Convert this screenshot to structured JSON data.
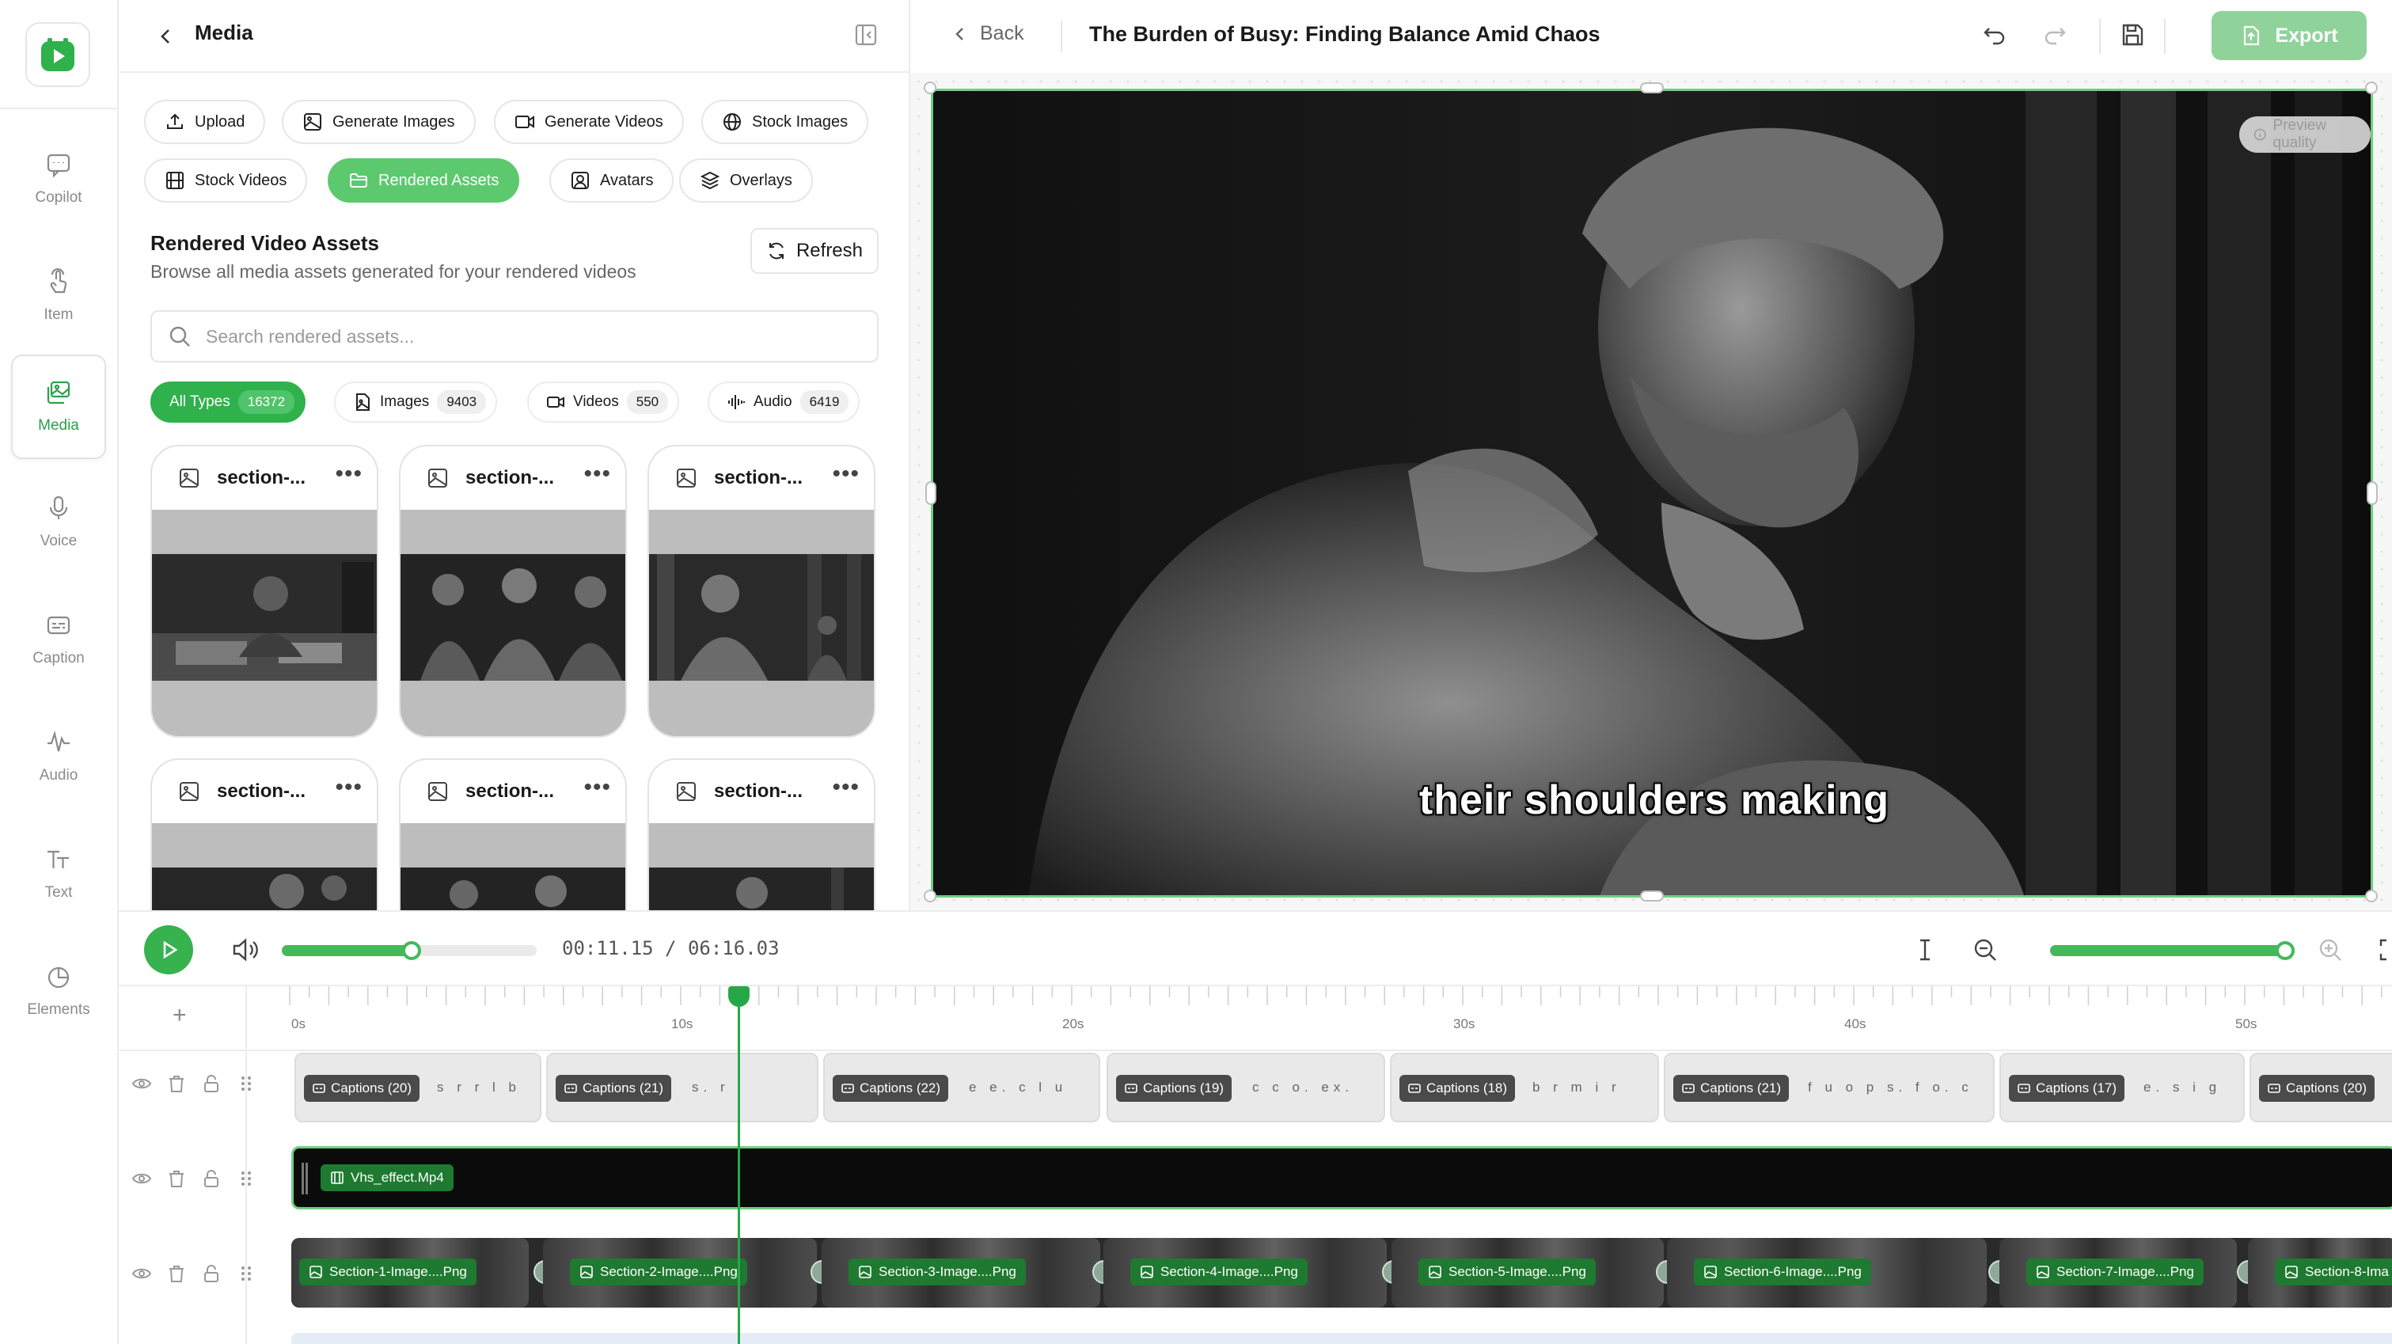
{
  "rail": {
    "items": [
      {
        "label": "Copilot",
        "icon": "chat-icon"
      },
      {
        "label": "Item",
        "icon": "pointer-icon"
      },
      {
        "label": "Media",
        "icon": "media-icon",
        "active": true
      },
      {
        "label": "Voice",
        "icon": "microphone-icon"
      },
      {
        "label": "Caption",
        "icon": "caption-icon"
      },
      {
        "label": "Audio",
        "icon": "audio-wave-icon"
      },
      {
        "label": "Text",
        "icon": "text-icon"
      },
      {
        "label": "Elements",
        "icon": "elements-icon"
      }
    ]
  },
  "panel": {
    "title": "Media",
    "sources": [
      {
        "label": "Upload",
        "icon": "upload-icon"
      },
      {
        "label": "Generate Images",
        "icon": "image-icon"
      },
      {
        "label": "Generate Videos",
        "icon": "video-icon"
      },
      {
        "label": "Stock Images",
        "icon": "globe-icon"
      },
      {
        "label": "Stock Videos",
        "icon": "film-icon"
      },
      {
        "label": "Rendered Assets",
        "icon": "folder-icon",
        "active": true
      },
      {
        "label": "Avatars",
        "icon": "avatar-icon"
      },
      {
        "label": "Overlays",
        "icon": "layers-icon"
      }
    ],
    "section_title": "Rendered Video Assets",
    "section_subtitle": "Browse all media assets generated for your rendered videos",
    "refresh_label": "Refresh",
    "search_placeholder": "Search rendered assets...",
    "types": [
      {
        "label": "All Types",
        "count": "16372",
        "active": true
      },
      {
        "label": "Images",
        "count": "9403"
      },
      {
        "label": "Videos",
        "count": "550"
      },
      {
        "label": "Audio",
        "count": "6419"
      }
    ],
    "cards": [
      {
        "name": "section-..."
      },
      {
        "name": "section-..."
      },
      {
        "name": "section-..."
      },
      {
        "name": "section-..."
      },
      {
        "name": "section-..."
      },
      {
        "name": "section-..."
      }
    ],
    "more_glyph": "•••"
  },
  "topbar": {
    "back_label": "Back",
    "title": "The Burden of Busy: Finding Balance Amid Chaos",
    "export_label": "Export"
  },
  "preview": {
    "quality_label": "Preview quality",
    "caption": "their shoulders making"
  },
  "playback": {
    "timecode": "00:11.15 / 06:16.03",
    "progress": 0.51,
    "zoom": 0.97
  },
  "timeline": {
    "add_glyph": "+",
    "ruler_labels": [
      "0s",
      "10s",
      "20s",
      "30s",
      "40s",
      "50s"
    ],
    "caption_clips": [
      {
        "label": "Captions (20)",
        "words": "s r  r l  b"
      },
      {
        "label": "Captions (21)",
        "words": "s.  r  l"
      },
      {
        "label": "Captions (22)",
        "words": "e  e.  c l  u"
      },
      {
        "label": "Captions (19)",
        "words": "c  c  o.  ex."
      },
      {
        "label": "Captions (18)",
        "words": "b  r m  i r"
      },
      {
        "label": "Captions (21)",
        "words": "f u o  p s. f  o. c"
      },
      {
        "label": "Captions (17)",
        "words": "e.  s  i  g"
      },
      {
        "label": "Captions (20)",
        "words": ""
      }
    ],
    "effect_clip": "Vhs_effect.Mp4",
    "image_clips": [
      "Section-1-Image....Png",
      "Section-2-Image....Png",
      "Section-3-Image....Png",
      "Section-4-Image....Png",
      "Section-5-Image....Png",
      "Section-6-Image....Png",
      "Section-7-Image....Png",
      "Section-8-Ima"
    ]
  },
  "colors": {
    "accent": "#36b24f",
    "accent_light": "#5cc96f",
    "export_bg": "#8fd39a"
  }
}
